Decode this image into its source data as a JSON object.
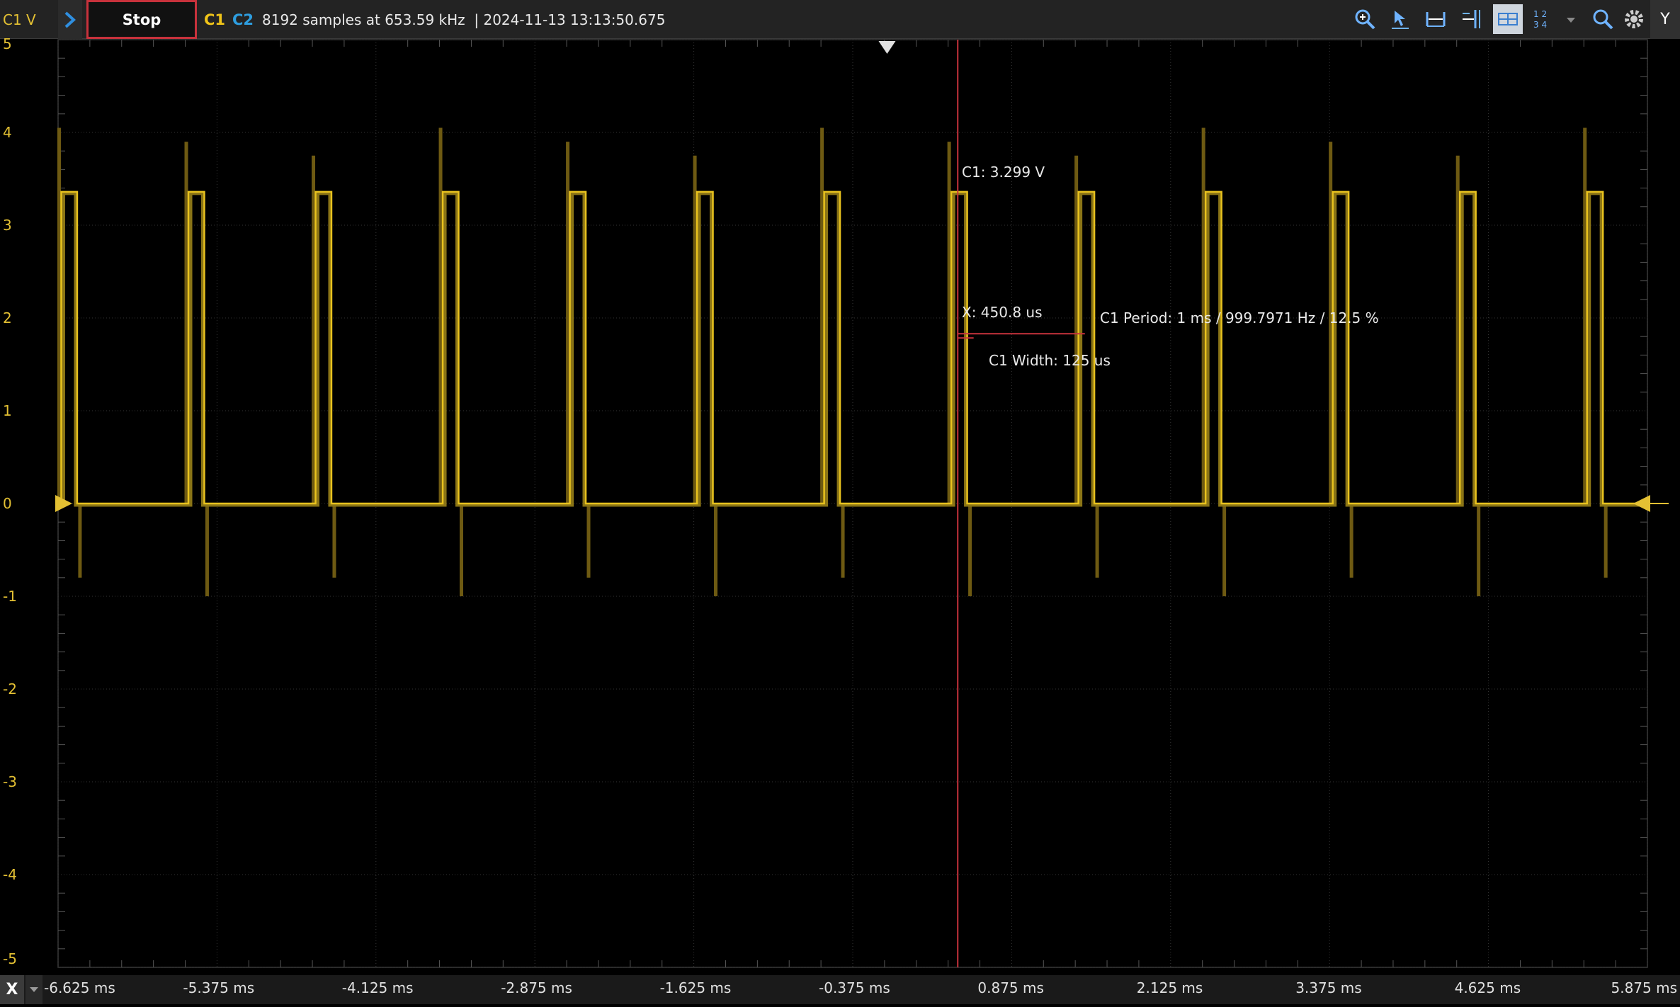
{
  "toolbar": {
    "y_unit_label": "C1 V",
    "stop_label": "Stop",
    "channel1_label": "C1",
    "channel2_label": "C2",
    "acquisition_info": "8192 samples at 653.59 kHz  | 2024-11-13 13:13:50.675",
    "y_axis_button": "Y",
    "icons": [
      "zoom-in-icon",
      "cursor-icon",
      "horizontal-cursor-icon",
      "vertical-cursor-icon",
      "grid-icon",
      "numbered-layout-icon",
      "chevron-down-icon",
      "zoom-icon",
      "settings-icon"
    ],
    "colors": {
      "channel1": "#f0c419",
      "channel2": "#2e9ee0",
      "cursor": "#c8323c",
      "stop_border": "#c8323c"
    }
  },
  "x_axis": {
    "unit_label": "X",
    "tick_labels": [
      "-6.625 ms",
      "-5.375 ms",
      "-4.125 ms",
      "-2.875 ms",
      "-1.625 ms",
      "-0.375 ms",
      "0.875 ms",
      "2.125 ms",
      "3.375 ms",
      "4.625 ms",
      "5.875 ms"
    ]
  },
  "y_axis": {
    "tick_labels": [
      "5",
      "4",
      "3",
      "2",
      "1",
      "0",
      "-1",
      "-2",
      "-3",
      "-4",
      "-5"
    ]
  },
  "measurements": {
    "cursor_value": "C1: 3.299 V",
    "cursor_x": "X: 450.8 us",
    "period": "C1 Period: 1 ms / 999.7971 Hz / 12.5 %",
    "width": "C1 Width: 125 us"
  },
  "chart_data": {
    "type": "line",
    "x_range_ms": [
      -6.625,
      5.875
    ],
    "y_range_v": [
      -5,
      5
    ],
    "series": [
      {
        "name": "C1",
        "signal": "pulse",
        "high_v": 3.36,
        "low_v": 0.0,
        "period_ms": 1.0,
        "pulse_width_ms": 0.125,
        "first_rising_edge_ms": -6.6,
        "pulse_count": 13
      }
    ],
    "cursor_x_ms": 0.4508,
    "trigger_level_v": 0,
    "grid": true
  }
}
